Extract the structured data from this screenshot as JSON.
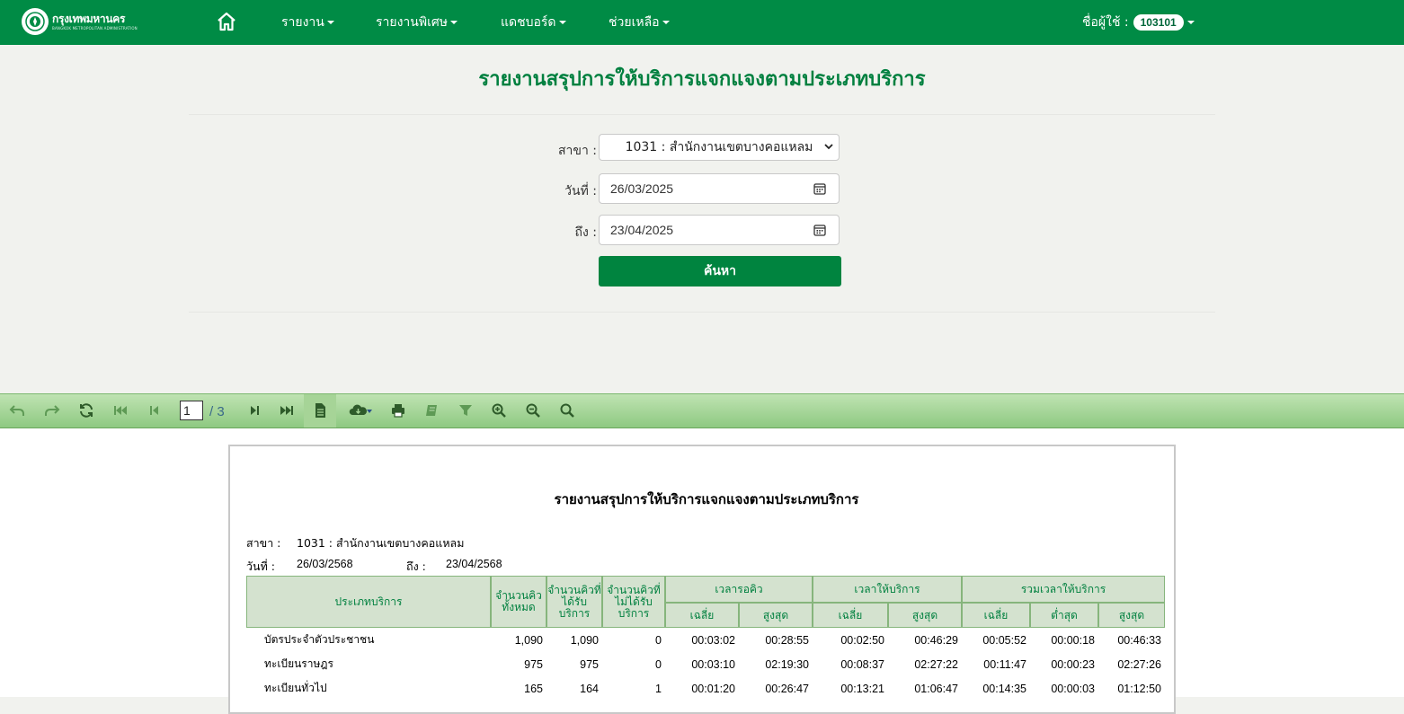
{
  "nav": {
    "logo_text": "กรุงเทพมหานคร",
    "logo_subtext": "BANGKOK METROPOLITAN ADMINISTRATION",
    "menus": [
      {
        "label": "รายงาน"
      },
      {
        "label": "รายงานพิเศษ"
      },
      {
        "label": "แดชบอร์ด"
      },
      {
        "label": "ช่วยเหลือ"
      }
    ],
    "user_label": "ชื่อผู้ใช้ :",
    "user_id": "103101"
  },
  "form": {
    "title": "รายงานสรุปการให้บริการแจกแจงตามประเภทบริการ",
    "branch_label": "สาขา :",
    "branch_value": "1031 : สำนักงานเขตบางคอแหลม",
    "date_from_label": "วันที่ :",
    "date_from": "26/03/2025",
    "date_to_label": "ถึง :",
    "date_to": "23/04/2025",
    "search_label": "ค้นหา"
  },
  "toolbar": {
    "current_page": "1",
    "total_pages": "/ 3"
  },
  "report": {
    "title": "รายงานสรุปการให้บริการแจกแจงตามประเภทบริการ",
    "branch_label": "สาขา :",
    "branch_value": "1031 : สำนักงานเขตบางคอแหลม",
    "date_label": "วันที่ :",
    "date_from": "26/03/2568",
    "date_to_label": "ถึง :",
    "date_to": "23/04/2568",
    "headers": {
      "service_type": "ประเภทบริการ",
      "total_queue": "จำนวนคิวทั้งหมด",
      "served": "จำนวนคิวที่ได้รับบริการ",
      "not_served": "จำนวนคิวที่ไม่ได้รับบริการ",
      "wait_time": "เวลารอคิว",
      "service_time": "เวลาให้บริการ",
      "total_service_time": "รวมเวลาให้บริการ",
      "avg": "เฉลี่ย",
      "max": "สูงสุด",
      "min": "ต่ำสุด"
    },
    "rows": [
      {
        "name": "บัตรประจำตัวประชาชน",
        "total": "1,090",
        "served": "1,090",
        "not_served": "0",
        "wait_avg": "00:03:02",
        "wait_max": "00:28:55",
        "svc_avg": "00:02:50",
        "svc_max": "00:46:29",
        "tot_avg": "00:05:52",
        "tot_min": "00:00:18",
        "tot_max": "00:46:33"
      },
      {
        "name": "ทะเบียนราษฎร",
        "total": "975",
        "served": "975",
        "not_served": "0",
        "wait_avg": "00:03:10",
        "wait_max": "02:19:30",
        "svc_avg": "00:08:37",
        "svc_max": "02:27:22",
        "tot_avg": "00:11:47",
        "tot_min": "00:00:23",
        "tot_max": "02:27:26"
      },
      {
        "name": "ทะเบียนทั่วไป",
        "total": "165",
        "served": "164",
        "not_served": "1",
        "wait_avg": "00:01:20",
        "wait_max": "00:26:47",
        "svc_avg": "00:13:21",
        "svc_max": "01:06:47",
        "tot_avg": "00:14:35",
        "tot_min": "00:00:03",
        "tot_max": "01:12:50"
      }
    ]
  },
  "colors": {
    "brand_green": "#008b45",
    "table_header_bg": "#d4e2cf",
    "toolbar_green": "#8ec981"
  }
}
